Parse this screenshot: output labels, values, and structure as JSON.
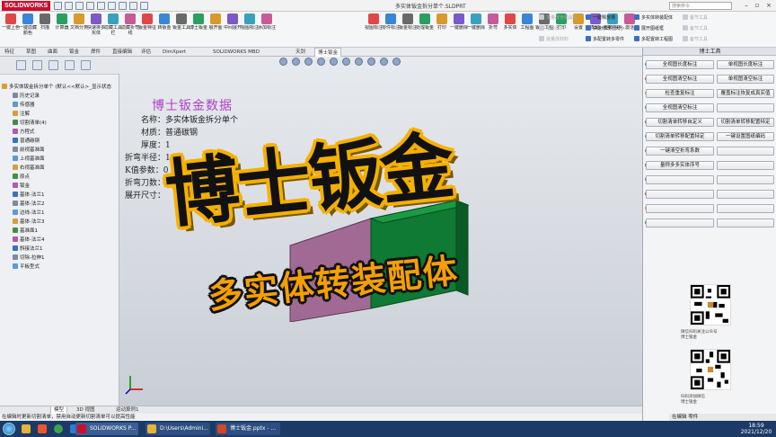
{
  "app": {
    "brand": "SOLIDWORKS",
    "document_title": "多实体钣金拆分单个.SLDPRT",
    "search_placeholder": "搜索命令"
  },
  "ribbon": {
    "buttons": [
      "一键上色",
      "一键隐藏颜色",
      "扫描",
      "计算器",
      "文档分类",
      "快速排多实体",
      "隐藏工具栏",
      "隐藏折弯线",
      "钣金特征",
      "转钣金",
      "钣金工具",
      "博士钣金",
      "展开图",
      "中间展开",
      "视图标注",
      "添加标注",
      "视图标注",
      "零件标注",
      "钣金标注",
      "处理钣金",
      "打印",
      "一键删除",
      "一键删除",
      "折弯",
      "多实体",
      "工程图",
      "钣金工程",
      "打印",
      "设置",
      "帮助",
      "重新排序",
      "激活"
    ],
    "checks_left": [
      {
        "label": "批量改全局属性",
        "on": false
      },
      {
        "label": "批量打印",
        "on": false
      },
      {
        "label": "批量改材料",
        "on": false
      }
    ],
    "checks_mid": [
      {
        "label": "一键释放槽",
        "on": true
      },
      {
        "label": "快速修改孔大小",
        "on": true
      },
      {
        "label": "多配置转多零件",
        "on": true
      }
    ],
    "checks_right": [
      {
        "label": "多实体转装配体",
        "on": true
      },
      {
        "label": "展开图纸框",
        "on": true
      },
      {
        "label": "多配置转工程图",
        "on": true
      }
    ],
    "checks_far": [
      {
        "label": "备节工具",
        "on": false
      },
      {
        "label": "备节工具",
        "on": false
      },
      {
        "label": "备节工具",
        "on": false
      }
    ]
  },
  "tabs": [
    "特征",
    "草图",
    "曲面",
    "钣金",
    "焊件",
    "直接编辑",
    "评估",
    "DimXpert",
    "SOLIDWORKS MBD",
    "天剑",
    "博士钣金"
  ],
  "active_tab": "博士钣金",
  "tree": {
    "root": "多实体钣金拆分单个 (默认<<默认>_显示状态",
    "items": [
      {
        "label": "历史记录",
        "indent": 1
      },
      {
        "label": "传感器",
        "indent": 1
      },
      {
        "label": "注解",
        "indent": 1
      },
      {
        "label": "切割清单(4)",
        "indent": 1
      },
      {
        "label": "方程式",
        "indent": 1
      },
      {
        "label": "普通碳钢",
        "indent": 1
      },
      {
        "label": "前视基准面",
        "indent": 1
      },
      {
        "label": "上视基准面",
        "indent": 1
      },
      {
        "label": "右视基准面",
        "indent": 1
      },
      {
        "label": "原点",
        "indent": 1
      },
      {
        "label": "钣金",
        "indent": 1
      },
      {
        "label": "基体-法兰1",
        "indent": 1
      },
      {
        "label": "基体-法兰2",
        "indent": 1
      },
      {
        "label": "边线-法兰1",
        "indent": 1
      },
      {
        "label": "基体-法兰3",
        "indent": 1
      },
      {
        "label": "基准面1",
        "indent": 1
      },
      {
        "label": "基体-法兰4",
        "indent": 1
      },
      {
        "label": "斜接法兰1",
        "indent": 1
      },
      {
        "label": "切除-拉伸1",
        "indent": 1
      },
      {
        "label": "平板型式",
        "indent": 1
      }
    ]
  },
  "info": {
    "title": "博士钣金数据",
    "lines": [
      "名称：多实体钣金拆分单个",
      "材质：普通碳钢",
      "厚度：1",
      "折弯半径：1.12",
      "K值参数：0",
      "折弯刀数：8",
      "展开尺寸："
    ]
  },
  "overlay": {
    "headline": "博士钣金",
    "subtitle": "多实体转装配体"
  },
  "model_tabs": [
    "模型",
    "3D 视图",
    "运动算例1"
  ],
  "status_text": "在编辑时更新切割清单，禁用自动更新切割清单可以提高性能",
  "right_panel": {
    "title": "博士工具",
    "buttons": [
      [
        "全视图长度标注",
        "单视图长度标注"
      ],
      [
        "全视图清空标注",
        "单视图清空标注"
      ],
      [
        "检查重复标注",
        "覆盖标注恢复成真实值"
      ],
      [
        "全视图清空标注",
        ""
      ],
      [
        "切割清单转移自定义",
        "切割清单转移配置特定"
      ],
      [
        "切割清单转移配置特定",
        "一键设置图纸编码"
      ],
      [
        "一键清空折弯系数",
        ""
      ],
      [
        "量称多多实体序号",
        ""
      ],
      [
        "",
        ""
      ],
      [
        "",
        ""
      ],
      [
        "",
        ""
      ],
      [
        "",
        ""
      ]
    ],
    "qr_captions": [
      [
        "微信扫码关注公众号",
        "博士钣金"
      ],
      [
        "扫码添加微信",
        "博士钣金"
      ]
    ]
  },
  "taskbar": {
    "items": [
      "SOLIDWORKS P...",
      "D:\\Users\\Admini...",
      "博士钣金.pptx - ..."
    ],
    "time": "18:59",
    "date": "2021/12/20",
    "ime": "在编辑 零件"
  }
}
